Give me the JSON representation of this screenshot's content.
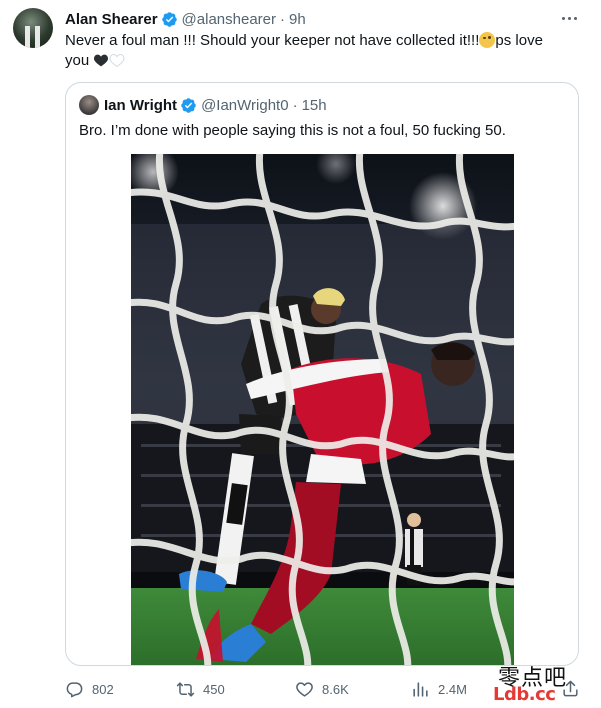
{
  "tweet": {
    "author_name": "Alan Shearer",
    "handle": "@alanshearer",
    "separator": "·",
    "time": "9h",
    "text_line1": "Never a foul man !!! Should your keeper not have collected it!!!",
    "text_after_emoji": "ps love",
    "text_line2": "you",
    "emojis": [
      "face-with-raised-eyebrow",
      "black-heart",
      "white-heart"
    ]
  },
  "quoted_tweet": {
    "author_name": "Ian Wright",
    "handle": "@IanWright0",
    "separator": "·",
    "time": "15h",
    "text": "Bro. I’m done with people saying this is not a foul, 50 fucking 50.",
    "media": "football-match-photo-through-goal-net"
  },
  "actions": {
    "replies": "802",
    "reposts": "450",
    "likes": "8.6K",
    "views": "2.4M"
  },
  "watermark": {
    "cn_text": "零点吧",
    "url": "Ldb.cc"
  },
  "colors": {
    "text_primary": "#0f1419",
    "text_secondary": "#536471",
    "verified_blue": "#1d9bf0",
    "border": "#cfd9de",
    "watermark_red": "#e53935"
  }
}
